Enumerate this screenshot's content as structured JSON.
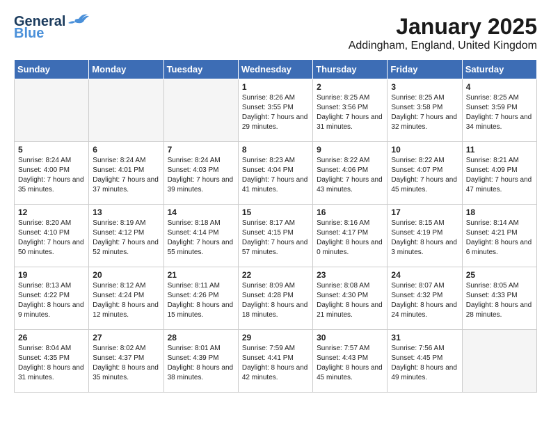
{
  "header": {
    "logo_general": "General",
    "logo_blue": "Blue",
    "month_title": "January 2025",
    "location": "Addingham, England, United Kingdom"
  },
  "weekdays": [
    "Sunday",
    "Monday",
    "Tuesday",
    "Wednesday",
    "Thursday",
    "Friday",
    "Saturday"
  ],
  "weeks": [
    [
      {
        "day": "",
        "sunrise": "",
        "sunset": "",
        "daylight": ""
      },
      {
        "day": "",
        "sunrise": "",
        "sunset": "",
        "daylight": ""
      },
      {
        "day": "",
        "sunrise": "",
        "sunset": "",
        "daylight": ""
      },
      {
        "day": "1",
        "sunrise": "Sunrise: 8:26 AM",
        "sunset": "Sunset: 3:55 PM",
        "daylight": "Daylight: 7 hours and 29 minutes."
      },
      {
        "day": "2",
        "sunrise": "Sunrise: 8:25 AM",
        "sunset": "Sunset: 3:56 PM",
        "daylight": "Daylight: 7 hours and 31 minutes."
      },
      {
        "day": "3",
        "sunrise": "Sunrise: 8:25 AM",
        "sunset": "Sunset: 3:58 PM",
        "daylight": "Daylight: 7 hours and 32 minutes."
      },
      {
        "day": "4",
        "sunrise": "Sunrise: 8:25 AM",
        "sunset": "Sunset: 3:59 PM",
        "daylight": "Daylight: 7 hours and 34 minutes."
      }
    ],
    [
      {
        "day": "5",
        "sunrise": "Sunrise: 8:24 AM",
        "sunset": "Sunset: 4:00 PM",
        "daylight": "Daylight: 7 hours and 35 minutes."
      },
      {
        "day": "6",
        "sunrise": "Sunrise: 8:24 AM",
        "sunset": "Sunset: 4:01 PM",
        "daylight": "Daylight: 7 hours and 37 minutes."
      },
      {
        "day": "7",
        "sunrise": "Sunrise: 8:24 AM",
        "sunset": "Sunset: 4:03 PM",
        "daylight": "Daylight: 7 hours and 39 minutes."
      },
      {
        "day": "8",
        "sunrise": "Sunrise: 8:23 AM",
        "sunset": "Sunset: 4:04 PM",
        "daylight": "Daylight: 7 hours and 41 minutes."
      },
      {
        "day": "9",
        "sunrise": "Sunrise: 8:22 AM",
        "sunset": "Sunset: 4:06 PM",
        "daylight": "Daylight: 7 hours and 43 minutes."
      },
      {
        "day": "10",
        "sunrise": "Sunrise: 8:22 AM",
        "sunset": "Sunset: 4:07 PM",
        "daylight": "Daylight: 7 hours and 45 minutes."
      },
      {
        "day": "11",
        "sunrise": "Sunrise: 8:21 AM",
        "sunset": "Sunset: 4:09 PM",
        "daylight": "Daylight: 7 hours and 47 minutes."
      }
    ],
    [
      {
        "day": "12",
        "sunrise": "Sunrise: 8:20 AM",
        "sunset": "Sunset: 4:10 PM",
        "daylight": "Daylight: 7 hours and 50 minutes."
      },
      {
        "day": "13",
        "sunrise": "Sunrise: 8:19 AM",
        "sunset": "Sunset: 4:12 PM",
        "daylight": "Daylight: 7 hours and 52 minutes."
      },
      {
        "day": "14",
        "sunrise": "Sunrise: 8:18 AM",
        "sunset": "Sunset: 4:14 PM",
        "daylight": "Daylight: 7 hours and 55 minutes."
      },
      {
        "day": "15",
        "sunrise": "Sunrise: 8:17 AM",
        "sunset": "Sunset: 4:15 PM",
        "daylight": "Daylight: 7 hours and 57 minutes."
      },
      {
        "day": "16",
        "sunrise": "Sunrise: 8:16 AM",
        "sunset": "Sunset: 4:17 PM",
        "daylight": "Daylight: 8 hours and 0 minutes."
      },
      {
        "day": "17",
        "sunrise": "Sunrise: 8:15 AM",
        "sunset": "Sunset: 4:19 PM",
        "daylight": "Daylight: 8 hours and 3 minutes."
      },
      {
        "day": "18",
        "sunrise": "Sunrise: 8:14 AM",
        "sunset": "Sunset: 4:21 PM",
        "daylight": "Daylight: 8 hours and 6 minutes."
      }
    ],
    [
      {
        "day": "19",
        "sunrise": "Sunrise: 8:13 AM",
        "sunset": "Sunset: 4:22 PM",
        "daylight": "Daylight: 8 hours and 9 minutes."
      },
      {
        "day": "20",
        "sunrise": "Sunrise: 8:12 AM",
        "sunset": "Sunset: 4:24 PM",
        "daylight": "Daylight: 8 hours and 12 minutes."
      },
      {
        "day": "21",
        "sunrise": "Sunrise: 8:11 AM",
        "sunset": "Sunset: 4:26 PM",
        "daylight": "Daylight: 8 hours and 15 minutes."
      },
      {
        "day": "22",
        "sunrise": "Sunrise: 8:09 AM",
        "sunset": "Sunset: 4:28 PM",
        "daylight": "Daylight: 8 hours and 18 minutes."
      },
      {
        "day": "23",
        "sunrise": "Sunrise: 8:08 AM",
        "sunset": "Sunset: 4:30 PM",
        "daylight": "Daylight: 8 hours and 21 minutes."
      },
      {
        "day": "24",
        "sunrise": "Sunrise: 8:07 AM",
        "sunset": "Sunset: 4:32 PM",
        "daylight": "Daylight: 8 hours and 24 minutes."
      },
      {
        "day": "25",
        "sunrise": "Sunrise: 8:05 AM",
        "sunset": "Sunset: 4:33 PM",
        "daylight": "Daylight: 8 hours and 28 minutes."
      }
    ],
    [
      {
        "day": "26",
        "sunrise": "Sunrise: 8:04 AM",
        "sunset": "Sunset: 4:35 PM",
        "daylight": "Daylight: 8 hours and 31 minutes."
      },
      {
        "day": "27",
        "sunrise": "Sunrise: 8:02 AM",
        "sunset": "Sunset: 4:37 PM",
        "daylight": "Daylight: 8 hours and 35 minutes."
      },
      {
        "day": "28",
        "sunrise": "Sunrise: 8:01 AM",
        "sunset": "Sunset: 4:39 PM",
        "daylight": "Daylight: 8 hours and 38 minutes."
      },
      {
        "day": "29",
        "sunrise": "Sunrise: 7:59 AM",
        "sunset": "Sunset: 4:41 PM",
        "daylight": "Daylight: 8 hours and 42 minutes."
      },
      {
        "day": "30",
        "sunrise": "Sunrise: 7:57 AM",
        "sunset": "Sunset: 4:43 PM",
        "daylight": "Daylight: 8 hours and 45 minutes."
      },
      {
        "day": "31",
        "sunrise": "Sunrise: 7:56 AM",
        "sunset": "Sunset: 4:45 PM",
        "daylight": "Daylight: 8 hours and 49 minutes."
      },
      {
        "day": "",
        "sunrise": "",
        "sunset": "",
        "daylight": ""
      }
    ]
  ]
}
